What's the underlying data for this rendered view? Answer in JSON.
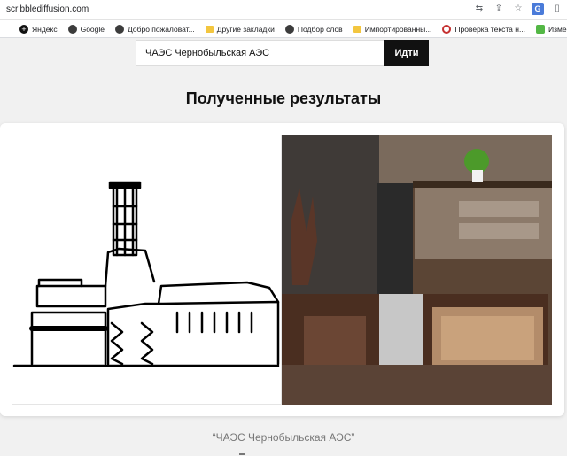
{
  "browser": {
    "url": "scribblediffusion.com",
    "actions": [
      "translate-icon",
      "share-icon",
      "star-icon",
      "extension-icon",
      "menu-icon"
    ],
    "bookmarks": [
      {
        "label": "",
        "icon": "apps-icon"
      },
      {
        "label": "Яндекс",
        "icon": "plus-icon"
      },
      {
        "label": "Google",
        "icon": "globe-icon"
      },
      {
        "label": "Добро пожаловат...",
        "icon": "globe-icon"
      },
      {
        "label": "Другие закладки",
        "icon": "folder-icon"
      },
      {
        "label": "Подбор слов",
        "icon": "globe-icon"
      },
      {
        "label": "Импортированны...",
        "icon": "folder-icon"
      },
      {
        "label": "Проверка текста н...",
        "icon": "c-icon"
      },
      {
        "label": "Изменить тональ...",
        "icon": "grn-icon"
      }
    ]
  },
  "search": {
    "value": "ЧАЭС Чернобыльская АЭС",
    "button": "Идти"
  },
  "results": {
    "heading": "Полученные результаты",
    "caption": "“ЧАЭС Чернобыльская АЭС”"
  },
  "colors": {
    "button_bg": "#111111",
    "page_bg": "#f1f1f1"
  }
}
